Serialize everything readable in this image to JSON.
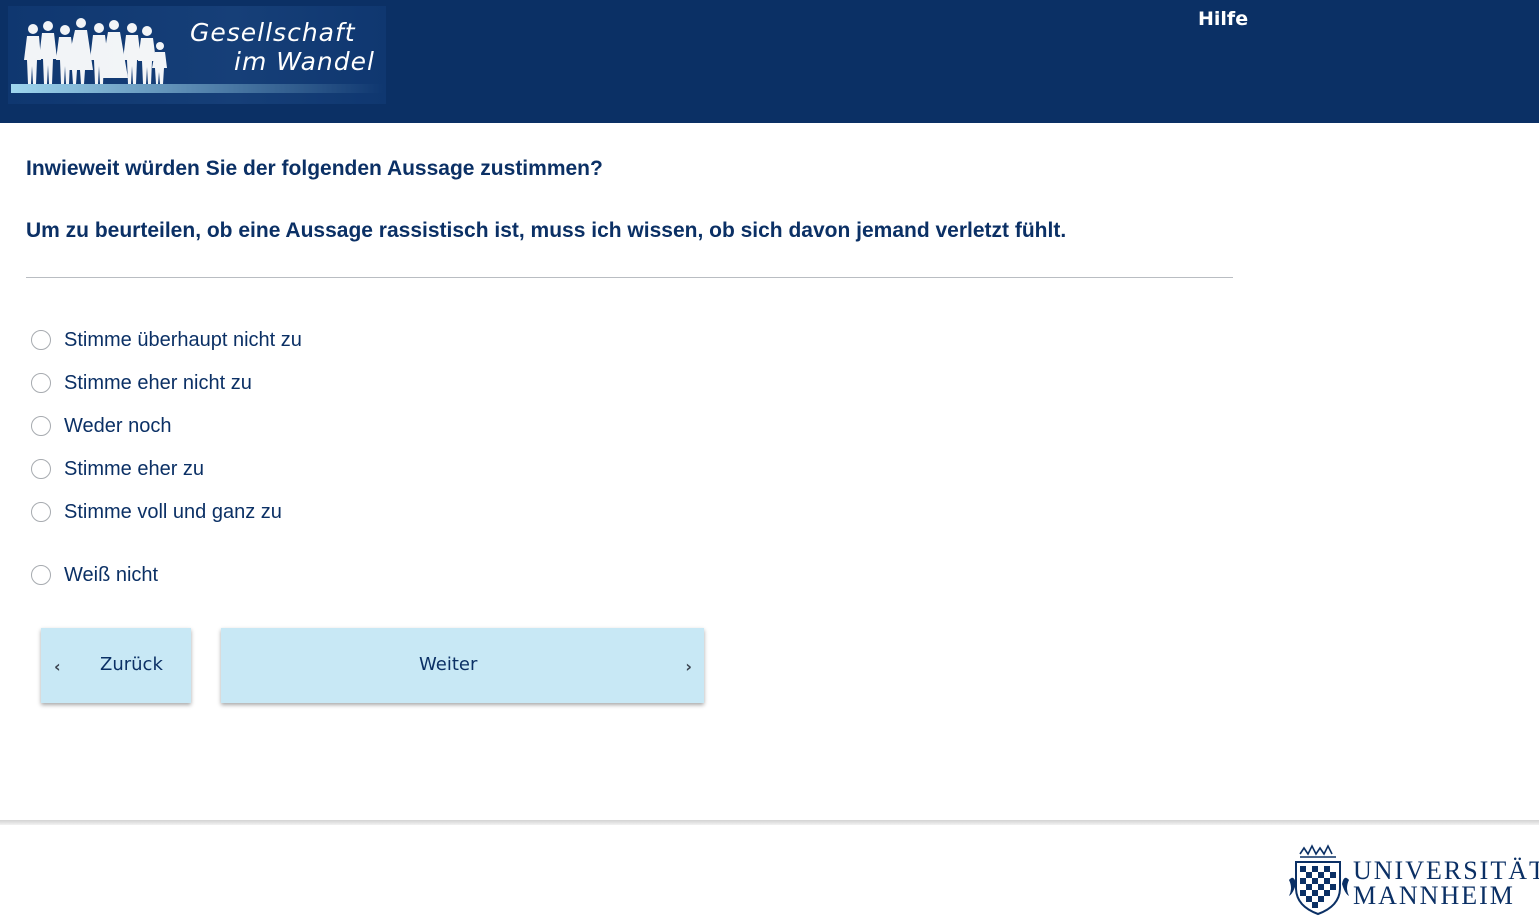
{
  "header": {
    "logo": {
      "line1": "Gesellschaft",
      "line2": "im Wandel",
      "icon": "people-silhouettes-icon"
    },
    "help_label": "Hilfe",
    "background_color": "#0b3065"
  },
  "question": {
    "intro": "Inwieweit würden Sie der folgenden Aussage zustimmen?",
    "statement": "Um zu beurteilen, ob eine Aussage rassistisch ist, muss ich wissen, ob sich davon jemand verletzt fühlt."
  },
  "options": [
    {
      "label": "Stimme überhaupt nicht zu",
      "selected": false
    },
    {
      "label": "Stimme eher nicht zu",
      "selected": false
    },
    {
      "label": "Weder noch",
      "selected": false
    },
    {
      "label": "Stimme eher zu",
      "selected": false
    },
    {
      "label": "Stimme voll und ganz zu",
      "selected": false
    },
    {
      "label": "Weiß nicht",
      "selected": false
    }
  ],
  "navigation": {
    "back_label": "Zurück",
    "next_label": "Weiter",
    "back_icon": "chevron-left-icon",
    "next_icon": "chevron-right-icon",
    "button_color": "#c8e8f5"
  },
  "footer": {
    "university_logo": {
      "line1": "UNIVERSITÄT",
      "line2": "MANNHEIM",
      "icon": "university-crest-icon"
    }
  }
}
